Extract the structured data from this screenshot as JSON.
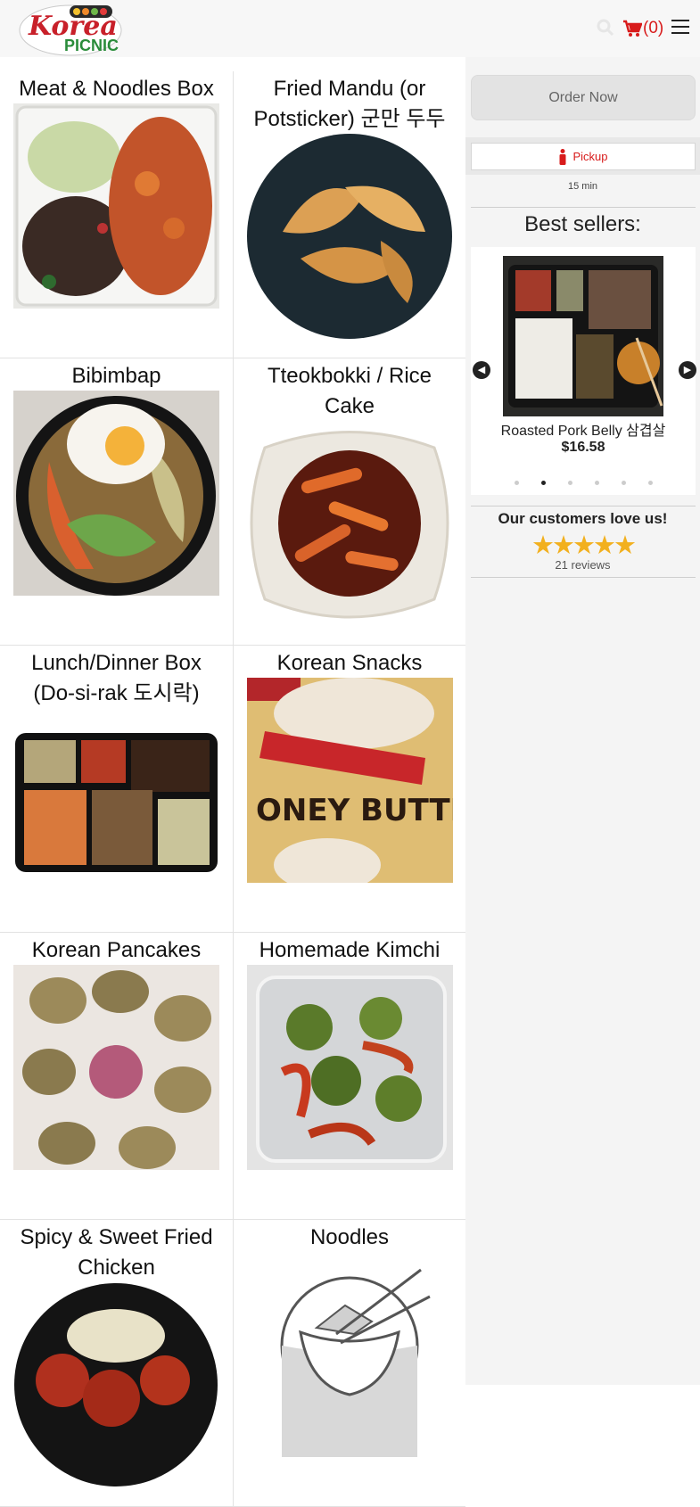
{
  "brand": {
    "line1": "Korea",
    "line2": "PICNIC"
  },
  "cart": {
    "count_text": "(0)"
  },
  "categories": [
    {
      "title": "Meat & Noodles Box"
    },
    {
      "title": "Fried Mandu (or Potsticker) 군만 두두"
    },
    {
      "title": "Bibimbap"
    },
    {
      "title": "Tteokbokki / Rice Cake"
    },
    {
      "title": "Lunch/Dinner Box (Do-si-rak 도시락)"
    },
    {
      "title": "Korean Snacks"
    },
    {
      "title": "Korean Pancakes"
    },
    {
      "title": "Homemade Kimchi"
    },
    {
      "title": "Spicy & Sweet Fried Chicken"
    },
    {
      "title": "Noodles"
    }
  ],
  "sidebar": {
    "order_now": "Order Now",
    "pickup_label": "Pickup",
    "pickup_time": "15 min",
    "best_sellers_title": "Best sellers:",
    "slide": {
      "name": "Roasted Pork Belly 삼겹살",
      "price": "$16.58"
    },
    "prev_label": "Previous",
    "next_label": "Next",
    "love_title": "Our customers love us!",
    "stars": "★★★★★",
    "reviews": "21 reviews"
  },
  "colors": {
    "accent": "#d81b1b",
    "header_bg": "#f7f7f7",
    "sidebar_bg": "#f4f4f4",
    "stars": "#f2b01e"
  }
}
